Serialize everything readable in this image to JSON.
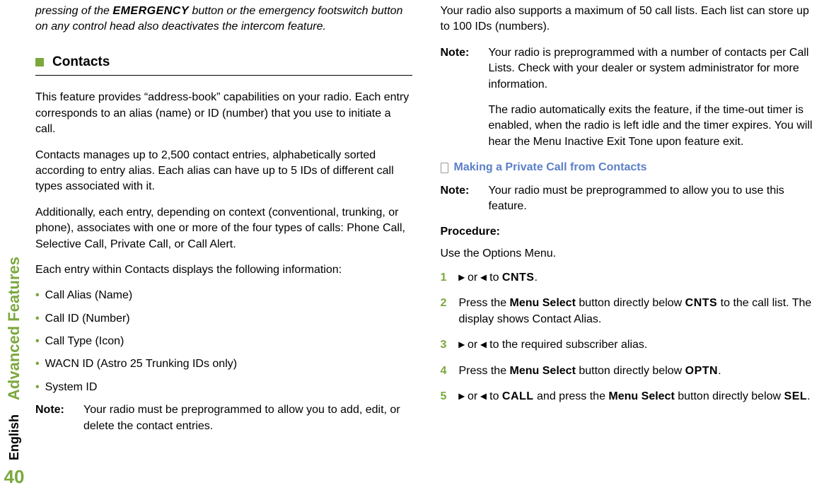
{
  "sidebar": {
    "label": "Advanced Features",
    "language": "English",
    "page": "40"
  },
  "col1": {
    "italic_intro_prefix": "pressing of the ",
    "italic_intro_emergency": "EMERGENCY",
    "italic_intro_suffix": " button or the emergency footswitch button on any control head also deactivates the intercom feature.",
    "contacts_title": "Contacts",
    "p1": "This feature provides “address-book” capabilities on your radio. Each entry corresponds to an alias (name) or ID (number) that you use to initiate a call.",
    "p2": "Contacts manages up to 2,500 contact entries, alphabetically sorted according to entry alias. Each alias can have up to 5 IDs of different call types associated with it.",
    "p3": "Additionally, each entry, depending on context (conventional, trunking, or phone), associates with one or more of the four types of calls: Phone Call, Selective Call, Private Call, or Call Alert.",
    "p4": "Each entry within Contacts displays the following information:",
    "bullets": [
      "Call Alias (Name)",
      "Call ID (Number)",
      "Call Type (Icon)",
      "WACN ID (Astro 25 Trunking IDs only)",
      "System ID"
    ],
    "note_label": "Note:",
    "note_text": "Your radio must be preprogrammed to allow you to add, edit, or delete the contact entries."
  },
  "col2": {
    "p1": "Your radio also supports a maximum of 50 call lists. Each list can store up to 100 IDs (numbers).",
    "note_label": "Note:",
    "note_text_a": "Your radio is preprogrammed with a number of contacts per Call Lists. Check with your dealer or system administrator for more information.",
    "note_text_b": "The radio automatically exits the feature, if the time-out timer is enabled, when the radio is left idle and the timer expires. You will hear the Menu Inactive Exit Tone upon feature exit.",
    "subsection_title": "Making a Private Call from Contacts",
    "sub_note_label": "Note:",
    "sub_note_text": "Your radio must be preprogrammed to allow you to use this feature.",
    "procedure_label": "Procedure:",
    "procedure_intro": "Use the Options Menu.",
    "step1": {
      "num": "1",
      "right": "▸",
      "left": "◂",
      "or": " or ",
      "to": " to ",
      "cnts": "CNTS",
      "end": "."
    },
    "step2": {
      "num": "2",
      "a": "Press the ",
      "menusel": "Menu Select",
      "b": " button directly below ",
      "cnts": "CNTS",
      "c": " to the call list. The display shows Contact Alias."
    },
    "step3": {
      "num": "3",
      "right": "▸",
      "or": " or ",
      "left": "◂",
      "text": " to the required subscriber alias."
    },
    "step4": {
      "num": "4",
      "a": "Press the ",
      "menusel": "Menu Select",
      "b": " button directly below ",
      "optn": "OPTN",
      "c": "."
    },
    "step5": {
      "num": "5",
      "right": "▸",
      "or": " or ",
      "left": "◂",
      "to": " to ",
      "call": "CALL",
      "mid": " and press the ",
      "menusel": "Menu Select",
      "b": " button directly below ",
      "sel": "SEL",
      "c": "."
    }
  }
}
